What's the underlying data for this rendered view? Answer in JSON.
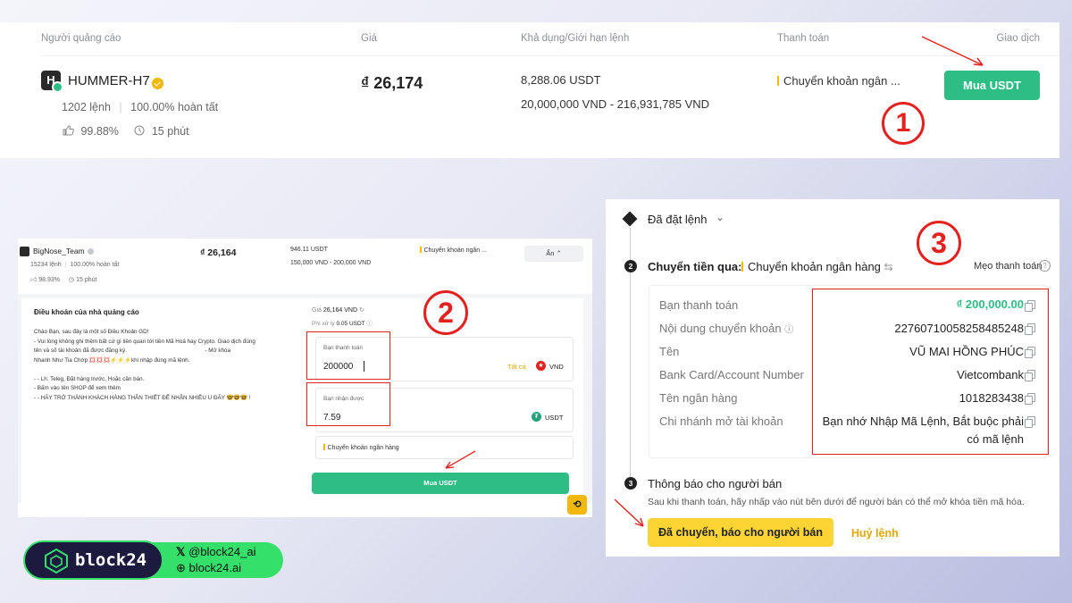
{
  "ad_list": {
    "headers": {
      "advertiser": "Người quảng cáo",
      "price": "Giá",
      "available": "Khả dụng/Giới hạn lệnh",
      "payment": "Thanh toán",
      "trade": "Giao dịch"
    },
    "merchant": {
      "logo_letter": "H",
      "name": "HUMMER-H7",
      "orders": "1202 lệnh",
      "completion": "100.00% hoàn tất",
      "rating": "99.88%",
      "time": "15 phút"
    },
    "price": "₫ 26,174",
    "available": "8,288.06 USDT",
    "limit": "20,000,000 VND - 216,931,785 VND",
    "payment_method": "Chuyển khoản ngân ...",
    "buy_label": "Mua USDT",
    "step_number": "1"
  },
  "order_form": {
    "merchant": {
      "name": "BigNose_Team",
      "orders": "15234 lệnh",
      "completion": "100.00% hoàn tất",
      "rating": "98.93%",
      "time": "15 phút"
    },
    "price": "₫ 26,164",
    "available": "946.11 USDT",
    "limit": "150,000 VND - 200,000 VND",
    "payment_method": "Chuyển khoản ngân ...",
    "hide_label": "Ẩn",
    "terms_title": "Điều khoản của nhà quảng cáo",
    "terms_lines": [
      "Chào Bạn, sau đây là một số Điều Khoản GD!",
      "- Vui lòng không ghi thêm bất cứ gì liên quan tới tiền Mã Hoá hay Crypto. Giao dịch đúng",
      "tên và số tài khoản đã được đăng ký.                                                  - Mở khóa",
      "Nhanh Như Tia Chớp 💢💢💢⚡⚡⚡khi nhập đúng mã lệnh.",
      "",
      "- - Lh: Teleg, Đặt hàng trước, Hoặc cần bán.",
      "- Bấm vào tên SHOP để xem thêm",
      "- - HÃY TRỞ THÀNH KHÁCH HÀNG THÂN THIẾT ĐỂ NHẬN NHIỀU U ĐÃY 🤓🤓🤓 !"
    ],
    "price_label": "Giá",
    "price_value": "26,164 VND",
    "fee_label": "Phí xử lý",
    "fee_value": "0.05 USDT",
    "pay_label": "Bạn thanh toán",
    "pay_value": "200000",
    "all_label": "Tất cả",
    "pay_currency": "VND",
    "receive_label": "Bạn nhận được",
    "receive_value": "7.59",
    "receive_currency": "USDT",
    "method": "Chuyển khoản ngân hàng",
    "buy_label": "Mua USDT",
    "step_number": "2"
  },
  "payment": {
    "step1_label": "Đã đặt lệnh",
    "step2_label": "Chuyển tiền qua:",
    "step2_method": "Chuyển khoản ngân hàng",
    "tip_label": "Mẹo thanh toán",
    "rows": [
      {
        "label": "Bạn thanh toán",
        "value": "₫ 200,000.00"
      },
      {
        "label": "Nội dung chuyển khoản",
        "value": "22760710058258485248"
      },
      {
        "label": "Tên",
        "value": "VŨ MAI HỒNG PHÚC"
      },
      {
        "label": "Bank Card/Account Number",
        "value": "Vietcombank"
      },
      {
        "label": "Tên ngân hàng",
        "value": "1018283438"
      },
      {
        "label": "Chi nhánh mở tài khoản",
        "value_line1": "Bạn nhớ Nhập Mã Lệnh, Bắt buộc phải",
        "value_line2": "có mã lệnh"
      }
    ],
    "step3_label": "Thông báo cho người bán",
    "step3_desc": "Sau khi thanh toán, hãy nhấp vào nút bên dưới để người bán có thể mở khóa tiền mã hóa.",
    "confirm_label": "Đã chuyển, báo cho người bán",
    "cancel_label": "Huỷ lệnh",
    "step_number": "3",
    "accent": "#2ebd85"
  },
  "brand": {
    "name": "block24",
    "twitter": "@block24_ai",
    "site": "block24.ai"
  }
}
